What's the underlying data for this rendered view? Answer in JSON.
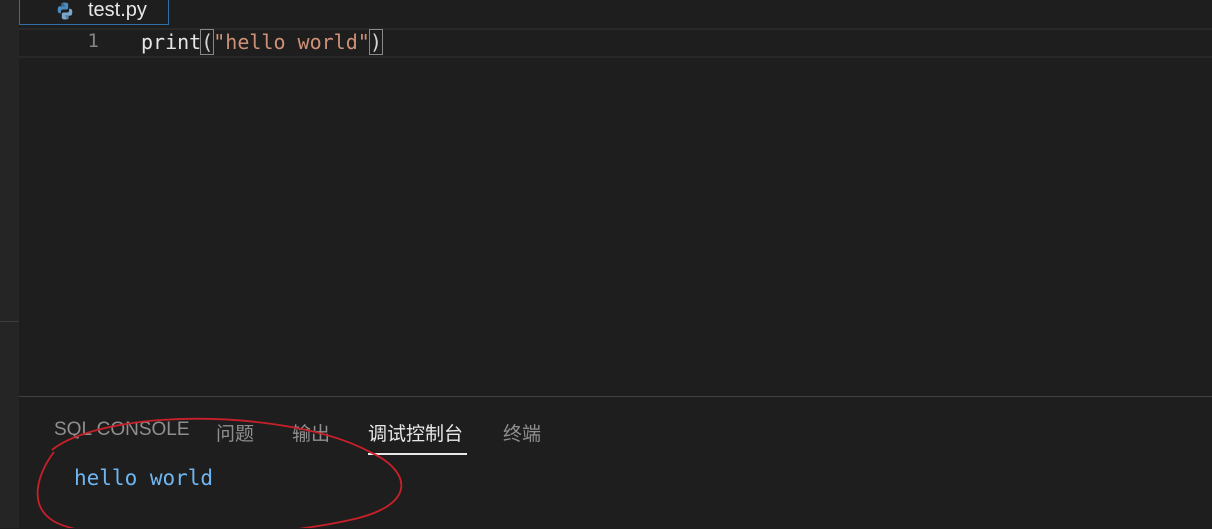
{
  "editor": {
    "tab": {
      "filename": "test.py",
      "icon": "python-icon"
    },
    "lines": [
      {
        "number": "1",
        "func": "print",
        "open": "(",
        "string": "\"hello world\"",
        "close": ")"
      }
    ]
  },
  "panel": {
    "tabs": [
      {
        "label": "SQL CONSOLE",
        "active": false
      },
      {
        "label": "问题",
        "active": false
      },
      {
        "label": "输出",
        "active": false
      },
      {
        "label": "调试控制台",
        "active": true
      },
      {
        "label": "终端",
        "active": false
      }
    ],
    "output": "hello world"
  },
  "colors": {
    "accent_tab_border": "#2f6fa7",
    "string": "#ce9178",
    "console_text": "#6fb5f2",
    "annotation": "#c8202a"
  }
}
